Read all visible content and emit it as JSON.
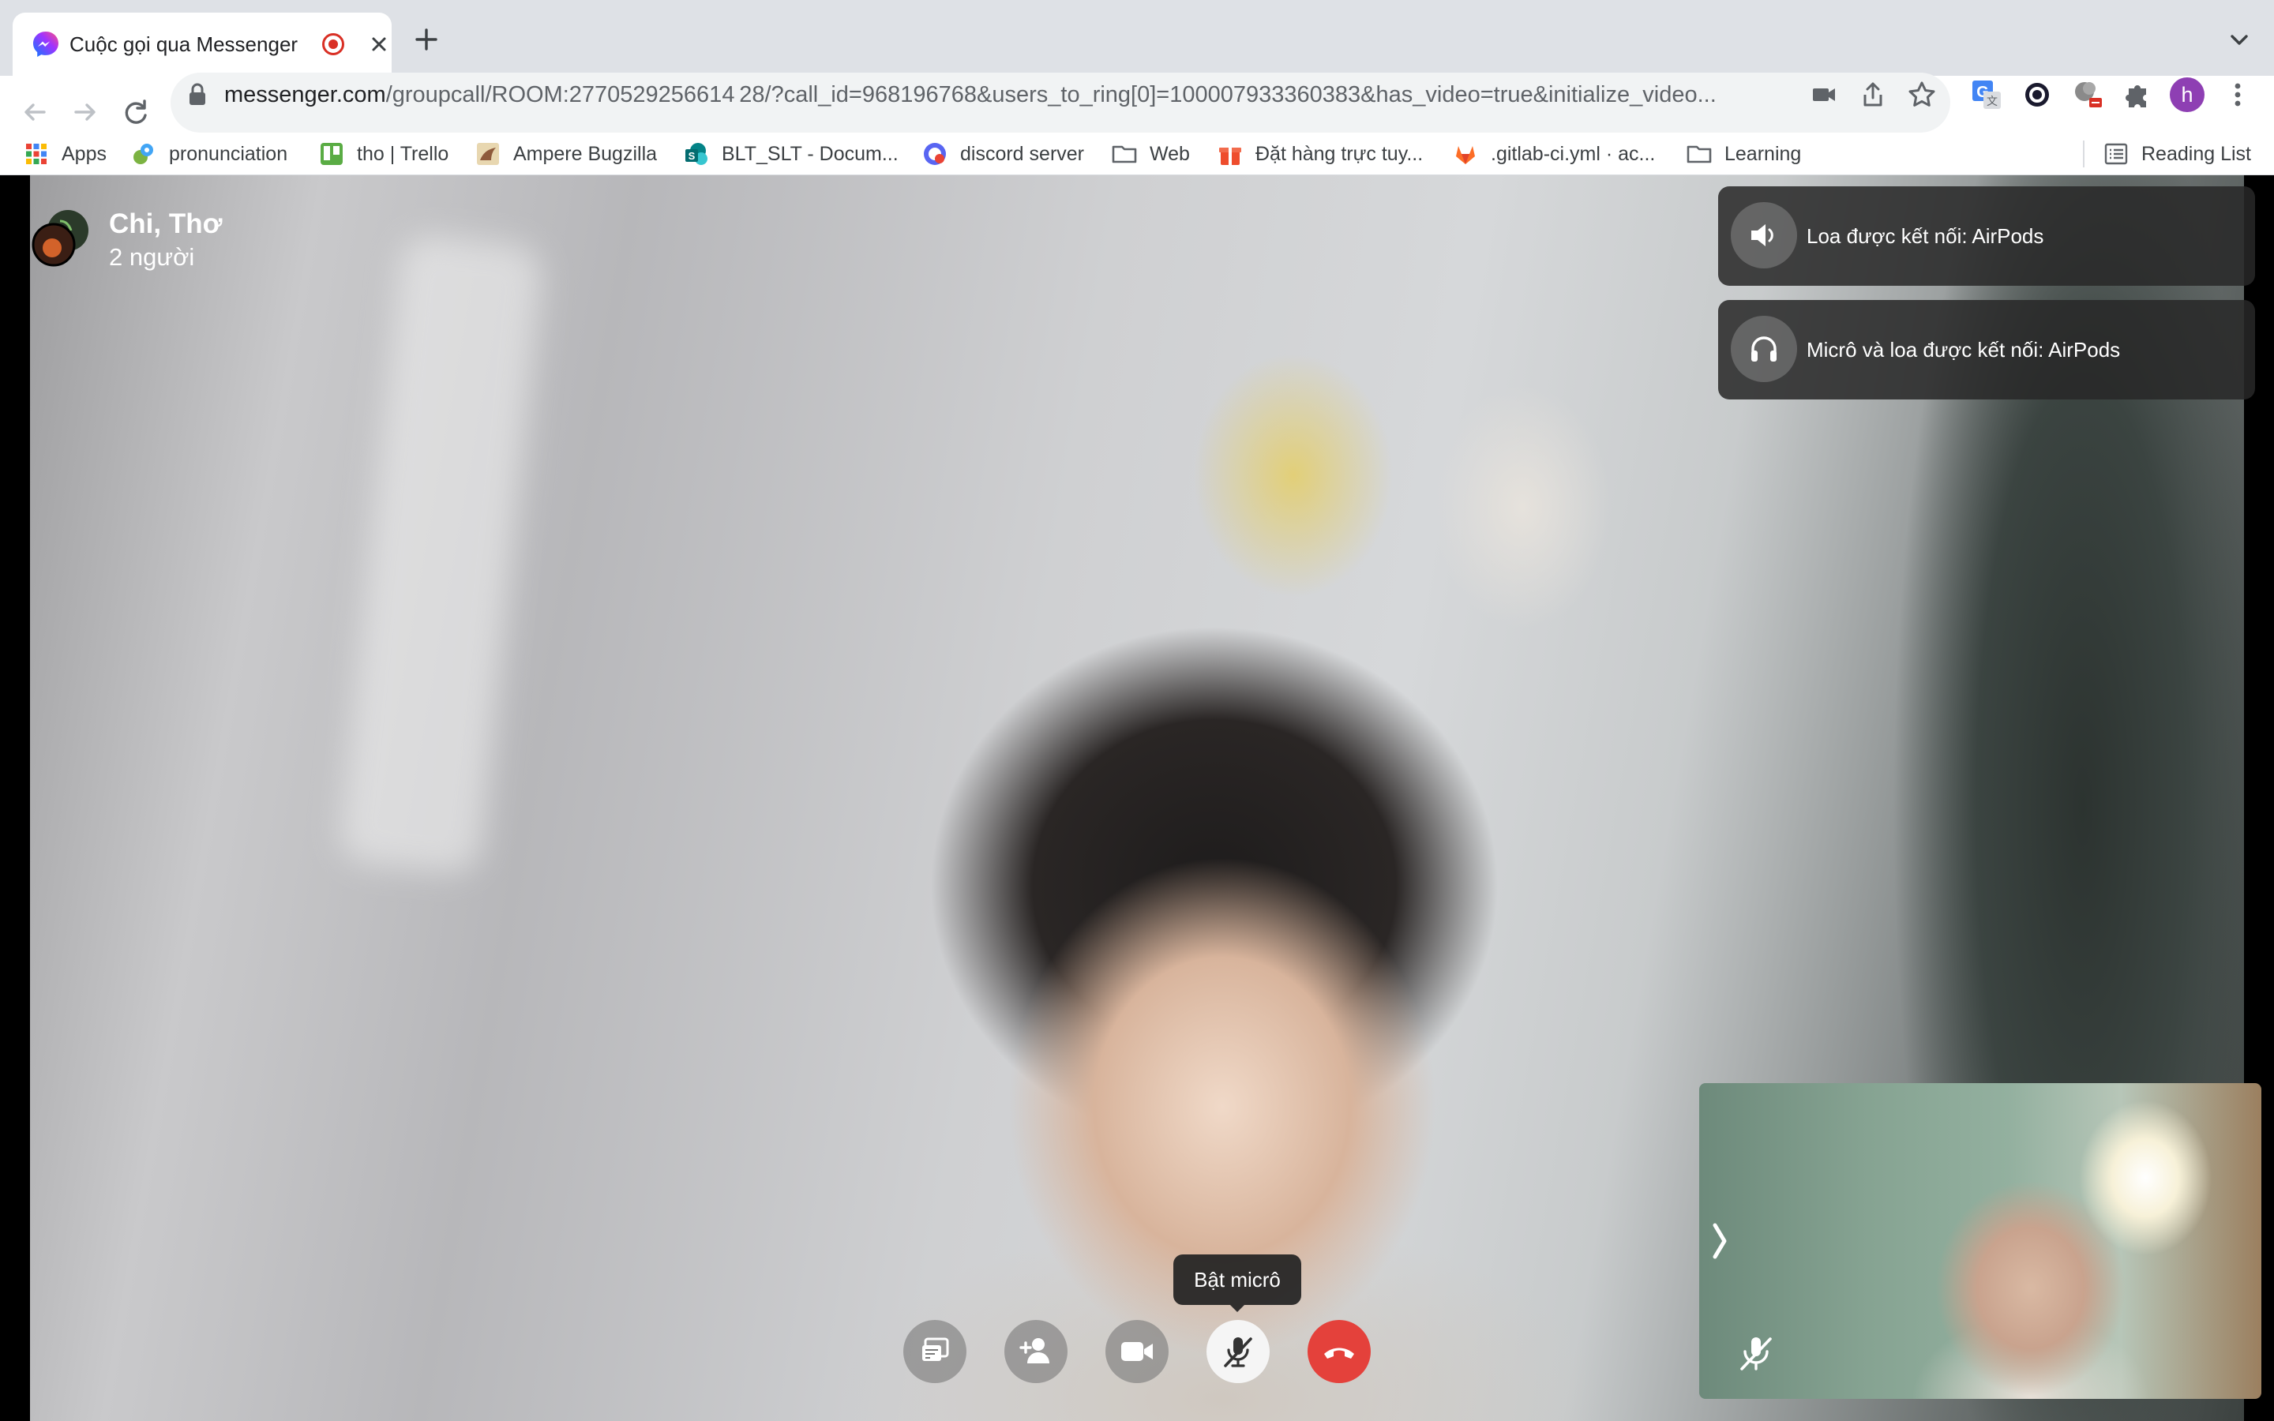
{
  "browser": {
    "tab": {
      "title": "Cuộc gọi qua Messenger"
    },
    "url": {
      "host": "messenger.com",
      "path": "/groupcall/ROOM:2770529256614 28/?call_id=968196768&users_to_ring[0]=100007933360383&has_video=true&initialize_video..."
    },
    "bookmarks": [
      {
        "label": "Apps",
        "icon": "apps-grid-icon"
      },
      {
        "label": "pronunciation",
        "icon": "pronunciation-icon"
      },
      {
        "label": "tho | Trello",
        "icon": "trello-icon"
      },
      {
        "label": "Ampere Bugzilla",
        "icon": "bugzilla-icon"
      },
      {
        "label": "BLT_SLT - Docum...",
        "icon": "sharepoint-icon"
      },
      {
        "label": "discord server",
        "icon": "discord-icon"
      },
      {
        "label": "Web",
        "icon": "folder-icon"
      },
      {
        "label": "Đặt hàng trực tuy...",
        "icon": "gift-icon"
      },
      {
        "label": ".gitlab-ci.yml · ac...",
        "icon": "gitlab-icon"
      },
      {
        "label": "Learning",
        "icon": "folder-icon"
      }
    ],
    "reading_list": "Reading List",
    "profile_initial": "h"
  },
  "call": {
    "title": "Chi, Thơ",
    "subtitle": "2 người",
    "notices": [
      {
        "text": "Loa được kết nối: AirPods",
        "icon": "speaker-icon"
      },
      {
        "text": "Micrô và loa được kết nối: AirPods",
        "icon": "headphones-icon"
      }
    ],
    "tooltip": "Bật micrô",
    "controls": [
      "share-screen",
      "add-person",
      "camera",
      "mic-off",
      "end-call"
    ]
  }
}
